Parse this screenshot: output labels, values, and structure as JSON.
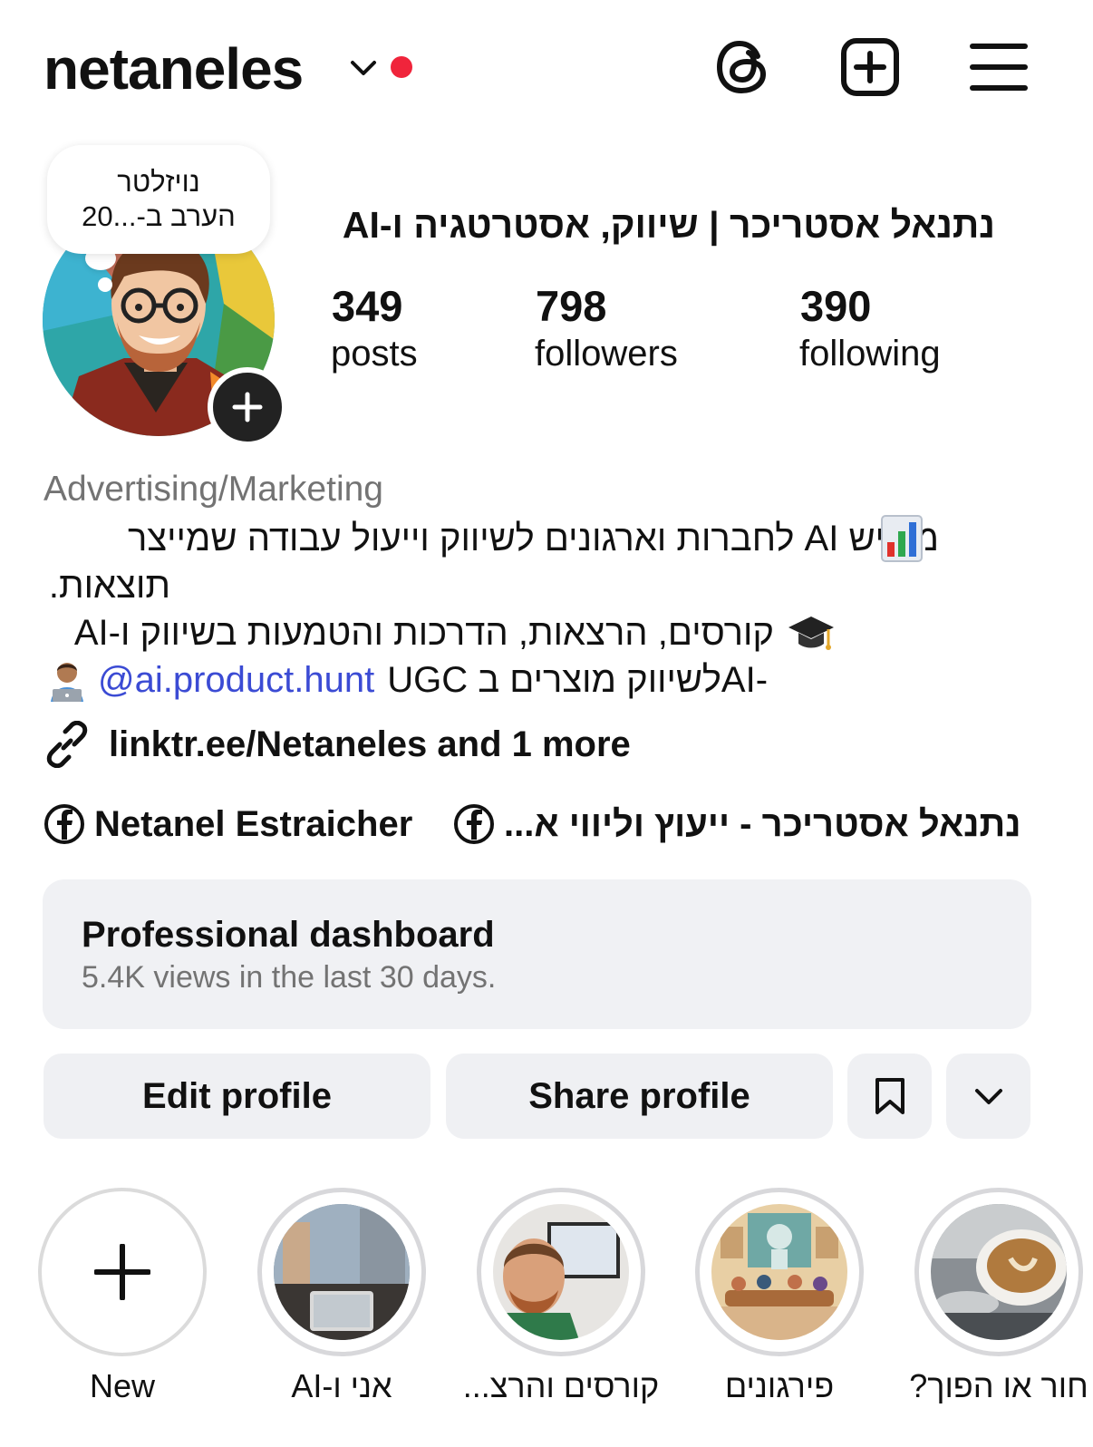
{
  "header": {
    "username": "netaneles",
    "icons": [
      "chevron-down-icon",
      "threads-icon",
      "new-post-icon",
      "menu-icon"
    ],
    "notification_dot_color": "#f0243b"
  },
  "note": {
    "line1": "נויזלטר",
    "line2": "הערב ב-...20"
  },
  "profile": {
    "display_name": "נתנאל אסטריכר | שיווק, אסטרטגיה ו-AI",
    "stats": [
      {
        "value": "349",
        "label": "posts"
      },
      {
        "value": "798",
        "label": "followers"
      },
      {
        "value": "390",
        "label": "following"
      }
    ],
    "category": "Advertising/Marketing",
    "bio": {
      "line1": "מנגיש AI לחברות וארגונים לשיווק וייעול עבודה שמייצר",
      "line2": "תוצאות.",
      "line3": "קורסים, הרצאות, הדרכות והטמעות בשיווק ו-AI",
      "line4_text": "לשיווק מוצרים ב UGC",
      "line4_prefix": "AI-",
      "mention": "@ai.product.hunt"
    },
    "link": "linktr.ee/Netaneles and 1 more",
    "facebook_links": [
      "Netanel Estraicher",
      "נתנאל אסטריכר - ייעוץ וליווי א..."
    ]
  },
  "dashboard": {
    "title": "Professional dashboard",
    "subtitle": "5.4K views in the last 30 days."
  },
  "buttons": {
    "edit": "Edit profile",
    "share": "Share profile"
  },
  "highlights": [
    {
      "label": "New"
    },
    {
      "label": "אני ו-AI"
    },
    {
      "label": "קורסים והרצ..."
    },
    {
      "label": "פירגונים"
    },
    {
      "label": "חור או הפוך?"
    }
  ]
}
